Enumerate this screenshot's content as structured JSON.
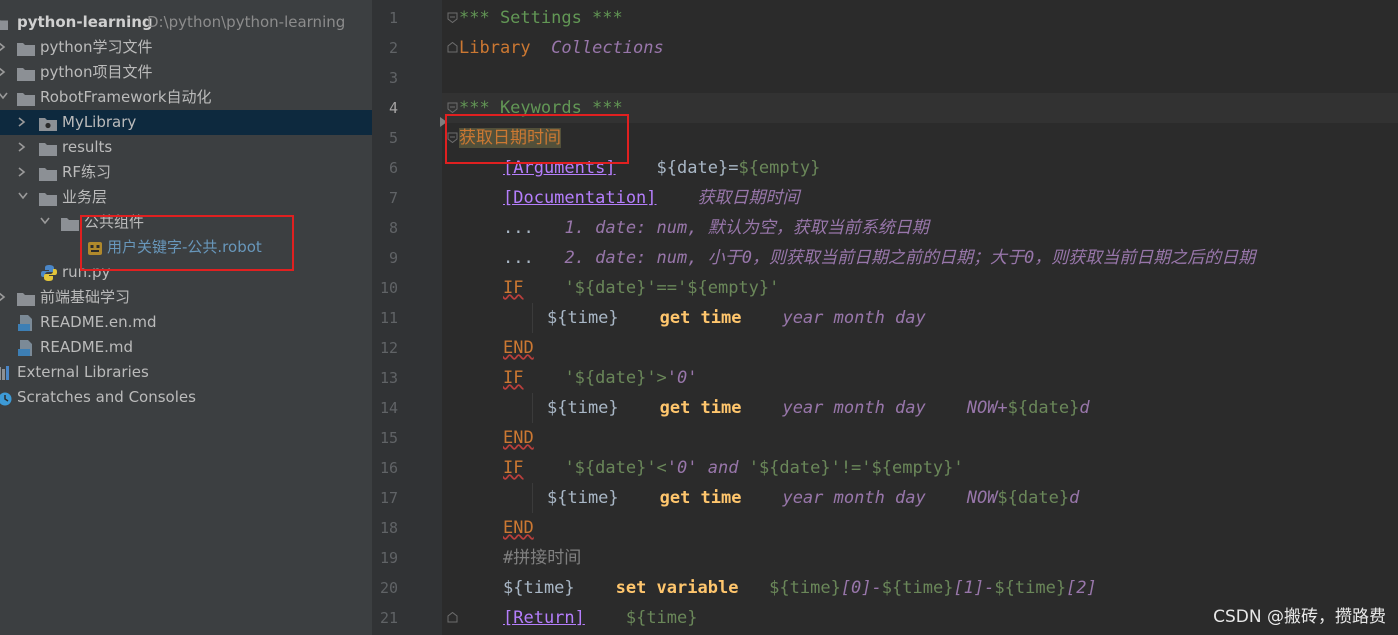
{
  "project_tree": {
    "root": {
      "label": "python-learning",
      "path": "D:\\python\\python-learning"
    },
    "items": [
      {
        "label": "python学习文件"
      },
      {
        "label": "python项目文件"
      },
      {
        "label": "RobotFramework自动化"
      },
      {
        "label": "MyLibrary"
      },
      {
        "label": "results"
      },
      {
        "label": "RF练习"
      },
      {
        "label": "业务层"
      },
      {
        "label": "公共组件"
      },
      {
        "label": "用户关键字-公共.robot"
      },
      {
        "label": "run.py"
      },
      {
        "label": "前端基础学习"
      },
      {
        "label": "README.en.md"
      },
      {
        "label": "README.md"
      },
      {
        "label": "External Libraries"
      },
      {
        "label": "Scratches and Consoles"
      }
    ]
  },
  "editor": {
    "line_numbers": [
      "1",
      "2",
      "3",
      "4",
      "5",
      "6",
      "7",
      "8",
      "9",
      "10",
      "11",
      "12",
      "13",
      "14",
      "15",
      "16",
      "17",
      "18",
      "19",
      "20",
      "21"
    ],
    "l1": "*** Settings ***",
    "l2_kw": "Library",
    "l2_val": "Collections",
    "l4": "*** Keywords ***",
    "l5": "获取日期时间",
    "l6_setting": "[Arguments]",
    "l6_var": "${date}",
    "l6_eq": "=",
    "l6_empty": "${empty}",
    "l7_setting": "[Documentation]",
    "l7_doc": "获取日期时间",
    "l8_dots": "...",
    "l8_doc": "1. date: num, 默认为空，获取当前系统日期",
    "l9_dots": "...",
    "l9_doc": "2. date: num, 小于0，则获取当前日期之前的日期；大于0，则获取当前日期之后的日期",
    "if": "IF",
    "end": "END",
    "l10_cond": "'${date}'=='${empty}'",
    "l11_var": "${time}",
    "l11_kw": "get time",
    "l11_arg": "year month day",
    "l13_cond_a": "'${date}'>",
    "l13_cond_b": "'0'",
    "l14_var": "${time}",
    "l14_kw": "get time",
    "l14_arg": "year month day",
    "l14_now": "NOW+",
    "l14_date": "${date}",
    "l14_d": "d",
    "l16_c1": "'${date}'<",
    "l16_c2": "'0'",
    "l16_and": " and ",
    "l16_c3": "'${date}'!='${empty}'",
    "l17_var": "${time}",
    "l17_kw": "get time",
    "l17_arg": "year month day",
    "l17_now": "NOW",
    "l17_date": "${date}",
    "l17_d": "d",
    "l19": "#拼接时间",
    "l20_var": "${time}",
    "l20_kw": "set variable",
    "l20_v1": "${time}",
    "l20_i0": "[0]",
    "l20_dash1": "-",
    "l20_v2": "${time}",
    "l20_i1": "[1]",
    "l20_dash2": "-",
    "l20_v3": "${time}",
    "l20_i2": "[2]",
    "l21_setting": "[Return]",
    "l21_var": "${time}"
  },
  "watermark": "CSDN @搬砖，攒路费",
  "colors": {
    "sidebar_bg": "#3c3f41",
    "editor_bg": "#2b2b2b",
    "selection": "#0d293e",
    "highlight_box": "#e02020"
  }
}
